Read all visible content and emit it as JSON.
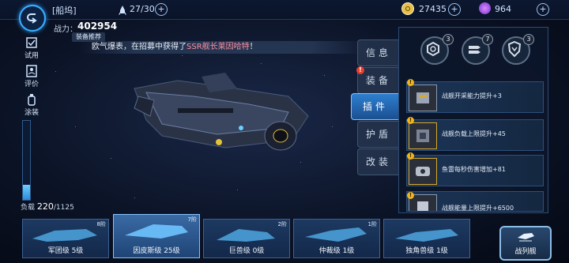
{
  "topbar": {
    "dock_title": "[船坞]",
    "fleet_count": "27/30",
    "plus": "+",
    "currency": "27435",
    "gems": "964"
  },
  "power": {
    "label": "战力：",
    "value": "402954"
  },
  "equip_recommend": "装备推荐",
  "marquee": {
    "prefix": "欧气爆表，在招募中获得了",
    "highlight": "SSR舰长莱因哈特",
    "suffix": "！"
  },
  "left_menu": [
    {
      "label": "试用",
      "icon": "check-icon"
    },
    {
      "label": "评价",
      "icon": "user-card-icon"
    },
    {
      "label": "涂装",
      "icon": "paint-bottle-icon"
    }
  ],
  "load": {
    "label": "负载",
    "value": "220",
    "max": "/1125",
    "fraction": 0.195
  },
  "tabs": [
    {
      "label": "信息",
      "active": false
    },
    {
      "label": "装备",
      "active": false,
      "alert": "!"
    },
    {
      "label": "插件",
      "active": true
    },
    {
      "label": "护盾",
      "active": false
    },
    {
      "label": "改装",
      "active": false
    }
  ],
  "plugin_slots": [
    {
      "icon": "hex-nut-icon",
      "count": "3"
    },
    {
      "icon": "missile-icon",
      "count": "7"
    },
    {
      "icon": "shield-emblem-icon",
      "count": "3"
    }
  ],
  "plugins": [
    {
      "text": "战舰开采能力提升+3"
    },
    {
      "text": "战舰负载上限提升+45"
    },
    {
      "text": "鱼雷每秒伤害增加+81"
    },
    {
      "text": "战舰能量上限提升+6500"
    }
  ],
  "ships": [
    {
      "name": "军团级 5级",
      "tier": "8阶",
      "selected": false
    },
    {
      "name": "因皮斯级 25级",
      "tier": "7阶",
      "selected": true
    },
    {
      "name": "巨兽级 0级",
      "tier": "2阶",
      "selected": false
    },
    {
      "name": "仲裁级 1级",
      "tier": "1阶",
      "selected": false
    },
    {
      "name": "独角兽级 1级",
      "tier": "",
      "selected": false
    }
  ],
  "fleet_button": "战列舰",
  "colors": {
    "accent": "#3bb1ff",
    "highlight": "#ff8fa0",
    "gold": "#d7a92a"
  }
}
